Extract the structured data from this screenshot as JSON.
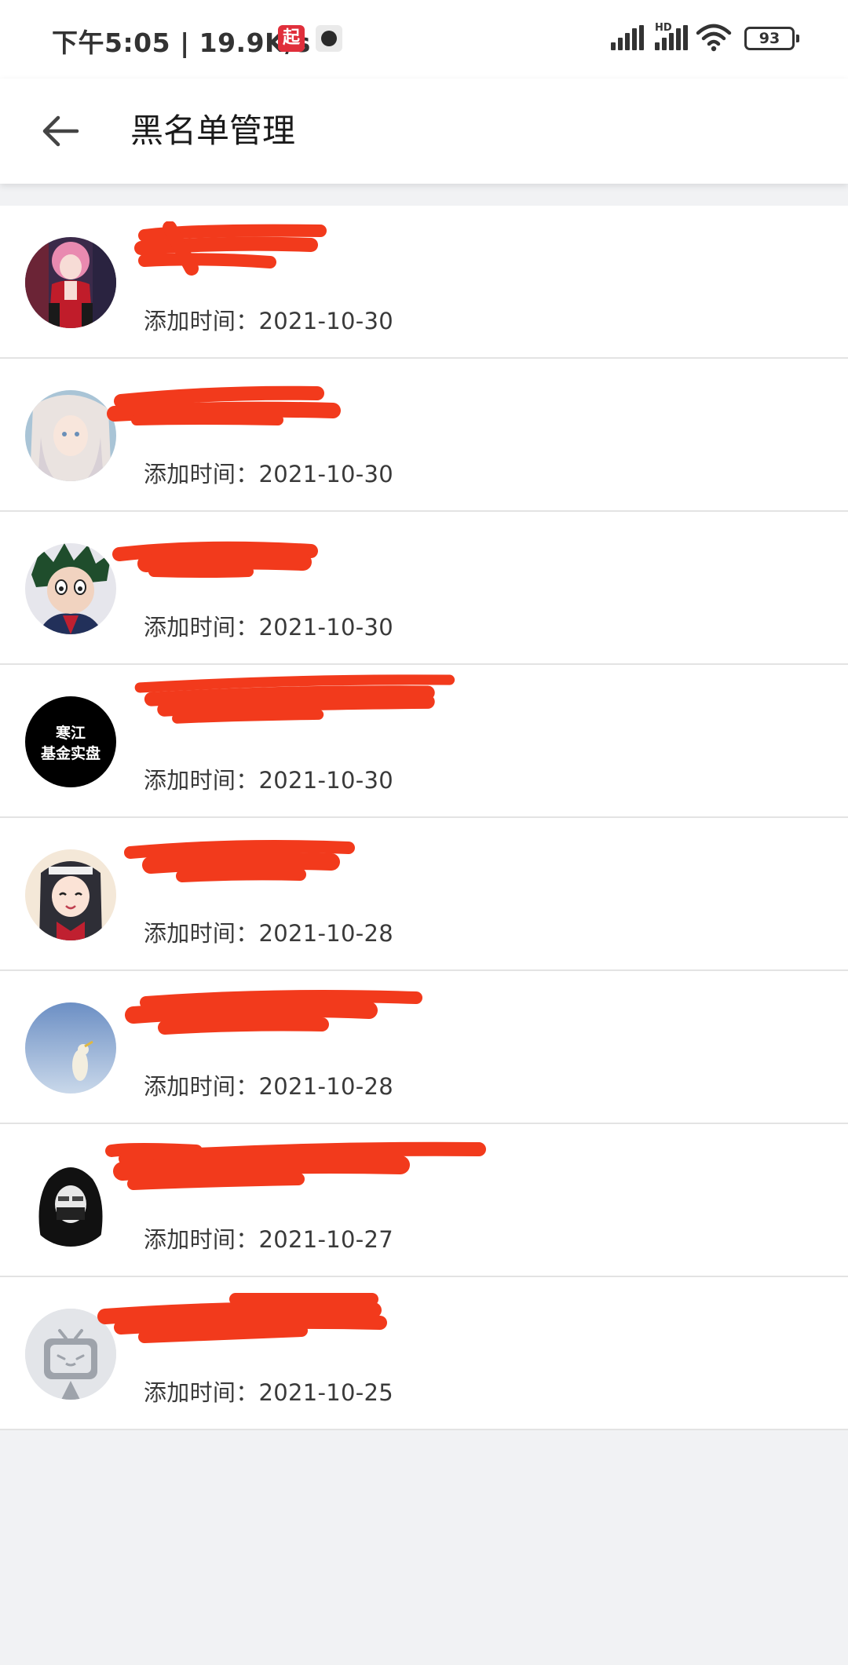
{
  "status_bar": {
    "time_speed": "下午5:05 | 19.9K/s",
    "app_badge": "起",
    "network_label": "HD",
    "battery": "93"
  },
  "header": {
    "title": "黑名单管理",
    "back_icon": "arrow-left-icon"
  },
  "blacklist": {
    "added_label": "添加时间：",
    "items": [
      {
        "avatar": "anime-girl-pink-hair",
        "avatar_colors": [
          "#3b2a4a",
          "#e98ab0"
        ],
        "added_date": "2021-10-30"
      },
      {
        "avatar": "anime-girl-white-hair",
        "avatar_colors": [
          "#a9c4d6",
          "#eae3e0"
        ],
        "added_date": "2021-10-30"
      },
      {
        "avatar": "anime-boy-green-hair",
        "avatar_colors": [
          "#1f4d2c",
          "#f1d3c0"
        ],
        "added_date": "2021-10-30"
      },
      {
        "avatar": "text-logo",
        "avatar_text": "寒江\n基金实盘",
        "avatar_colors": [
          "#000000",
          "#ffffff"
        ],
        "added_date": "2021-10-30"
      },
      {
        "avatar": "anime-girl-black-hair",
        "avatar_colors": [
          "#2e2e36",
          "#f4e8d8"
        ],
        "added_date": "2021-10-28"
      },
      {
        "avatar": "sky-bird",
        "avatar_colors": [
          "#6c8fc4",
          "#c9d8ea"
        ],
        "added_date": "2021-10-28"
      },
      {
        "avatar": "hooded-figure",
        "avatar_colors": [
          "#111111",
          "#e8e8e8"
        ],
        "added_date": "2021-10-27"
      },
      {
        "avatar": "default-tv-mascot",
        "avatar_colors": [
          "#e3e5e9",
          "#9ea3ab"
        ],
        "added_date": "2021-10-25"
      }
    ]
  },
  "colors": {
    "redaction": "#f23a1c",
    "page_background": "#f1f2f4",
    "card_background": "#ffffff",
    "divider": "#e3e3e3"
  }
}
